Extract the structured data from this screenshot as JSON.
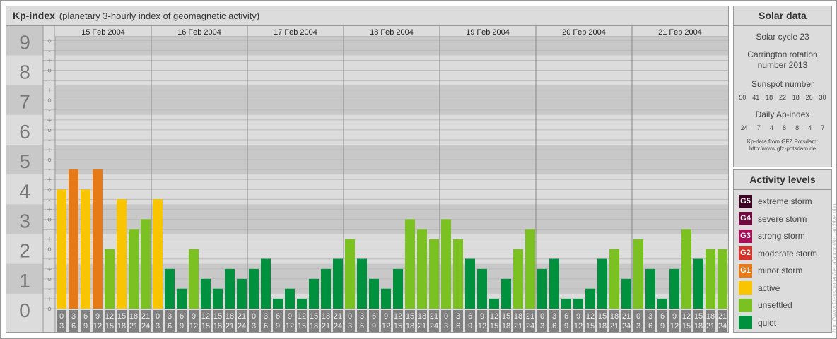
{
  "header": {
    "title": "Kp-index",
    "subtitle": "(planetary 3-hourly index of geomagnetic activity)"
  },
  "colors": {
    "quiet": "#00913f",
    "unsettled": "#7bc121",
    "active": "#f9c400",
    "G1": "#e57a17",
    "G2": "#d8312a",
    "G3": "#a8105a",
    "G4": "#6e0a3e",
    "G5": "#3c0423"
  },
  "chart_data": {
    "type": "bar",
    "title": "Kp-index",
    "ylim": [
      0,
      9
    ],
    "y_ticks": [
      "0",
      "1",
      "2",
      "3",
      "4",
      "5",
      "6",
      "7",
      "8",
      "9"
    ],
    "sub_ticks": [
      "-",
      "o",
      "+"
    ],
    "days": [
      "15 Feb 2004",
      "16 Feb 2004",
      "17 Feb 2004",
      "18 Feb 2004",
      "19 Feb 2004",
      "20 Feb 2004",
      "21 Feb 2004"
    ],
    "intervals": [
      [
        "0",
        "3"
      ],
      [
        "3",
        "6"
      ],
      [
        "6",
        "9"
      ],
      [
        "9",
        "12"
      ],
      [
        "12",
        "15"
      ],
      [
        "15",
        "18"
      ],
      [
        "18",
        "21"
      ],
      [
        "21",
        "24"
      ]
    ],
    "values": [
      [
        4,
        4.67,
        4,
        4.67,
        2,
        3.67,
        2.67,
        3
      ],
      [
        3.67,
        1.33,
        0.67,
        2,
        1,
        0.67,
        1.33,
        1
      ],
      [
        1.33,
        1.67,
        0.33,
        0.67,
        0.33,
        1,
        1.33,
        1.67
      ],
      [
        2.33,
        1.67,
        1,
        0.67,
        1.33,
        3,
        2.67,
        2.33
      ],
      [
        3,
        2.33,
        1.67,
        1.33,
        0.33,
        1,
        2,
        2.67
      ],
      [
        1.33,
        1.67,
        0.33,
        0.33,
        0.67,
        1.67,
        2,
        1
      ],
      [
        2.33,
        1.33,
        0.33,
        1.33,
        2.67,
        1.67,
        2,
        2
      ]
    ]
  },
  "solar": {
    "title": "Solar data",
    "cycle": "Solar cycle 23",
    "carrington": [
      "Carrington rotation",
      "number 2013"
    ],
    "sunspot_label": "Sunspot number",
    "sunspots": [
      "50",
      "41",
      "18",
      "22",
      "18",
      "26",
      "30"
    ],
    "ap_label": "Daily Ap-index",
    "ap": [
      "24",
      "7",
      "4",
      "8",
      "8",
      "4",
      "7"
    ],
    "credit": [
      "Kp-data from GFZ Potsdam:",
      "http://www.gfz-potsdam.de"
    ]
  },
  "activity": {
    "title": "Activity levels",
    "levels": [
      {
        "badge": "G5",
        "label": "extreme storm",
        "color": "#3c0423"
      },
      {
        "badge": "G4",
        "label": "severe storm",
        "color": "#6e0a3e"
      },
      {
        "badge": "G3",
        "label": "strong storm",
        "color": "#a8105a"
      },
      {
        "badge": "G2",
        "label": "moderate storm",
        "color": "#d8312a"
      },
      {
        "badge": "G1",
        "label": "minor storm",
        "color": "#e57a17"
      },
      {
        "badge": "",
        "label": "active",
        "color": "#f9c400"
      },
      {
        "badge": "",
        "label": "unsettled",
        "color": "#7bc121"
      },
      {
        "badge": "",
        "label": "quiet",
        "color": "#00913f"
      }
    ]
  },
  "source_url": "http://www.fheusner.eu/terra/aurora/kp_archive.php"
}
